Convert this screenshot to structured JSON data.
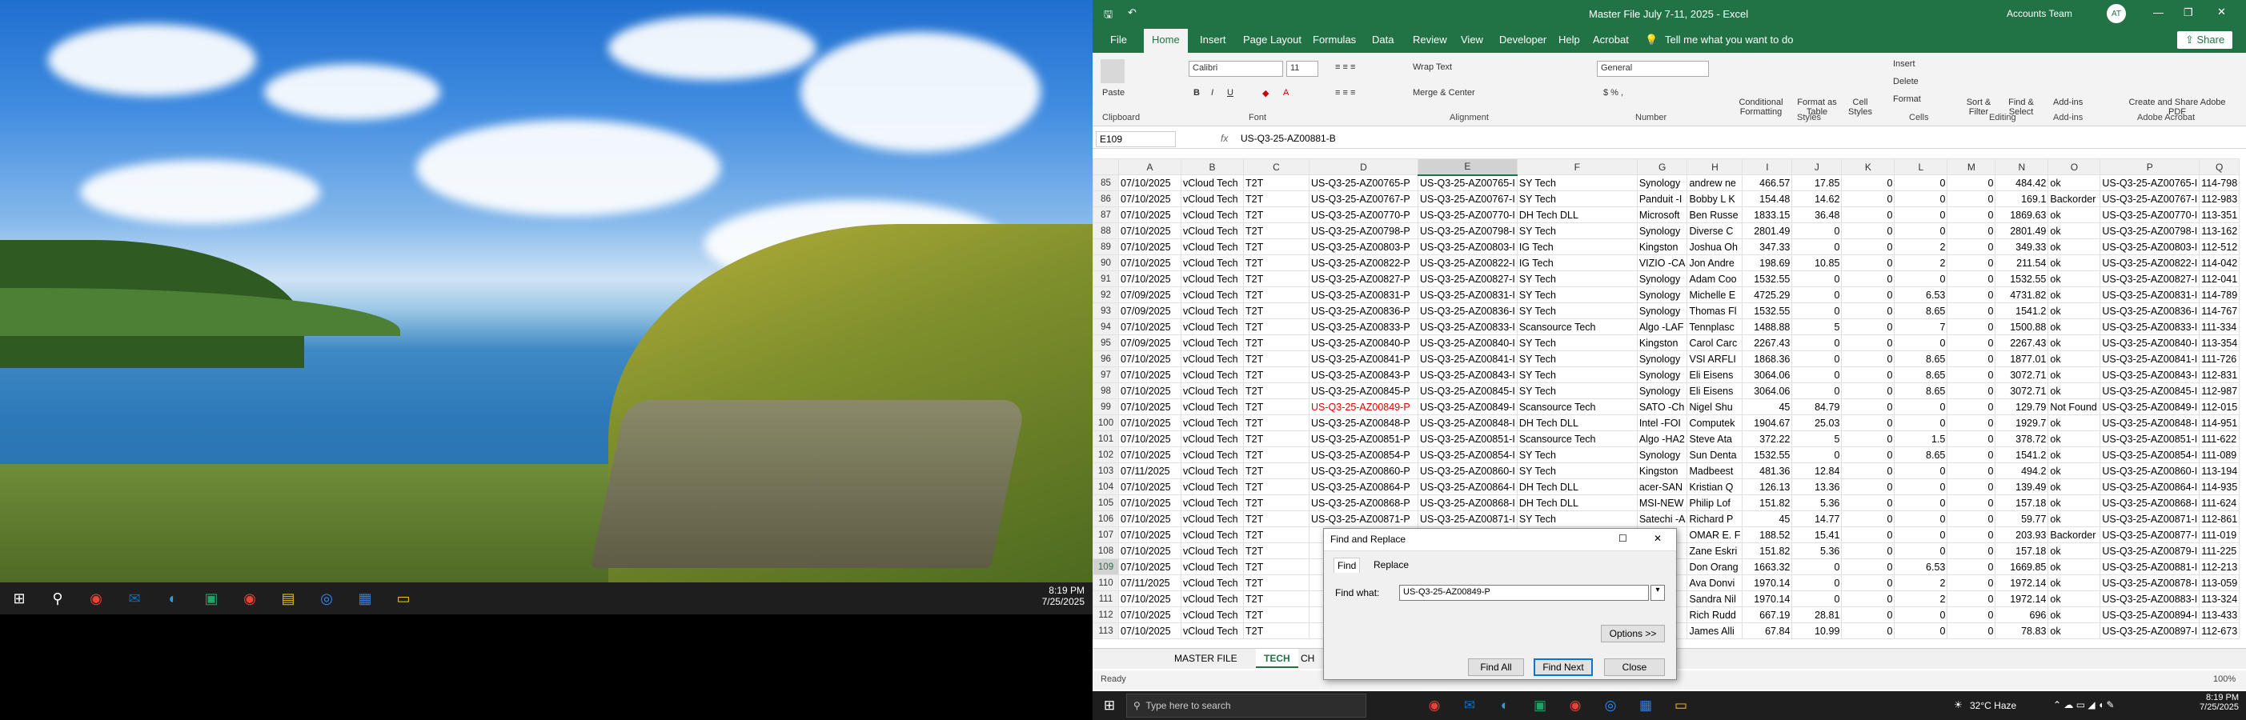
{
  "left_taskbar": {
    "time": "8:19 PM",
    "date": "7/25/2025"
  },
  "title_bar": {
    "file_name": "Master File July 7-11, 2025 - Excel",
    "account": "Accounts Team",
    "initials": "AT"
  },
  "ribbon_tabs": [
    "File",
    "Home",
    "Insert",
    "Page Layout",
    "Formulas",
    "Data",
    "Review",
    "View",
    "Developer",
    "Help",
    "Acrobat",
    "Tell me what you want to do"
  ],
  "share_label": "Share",
  "ribbon": {
    "paste": "Paste",
    "clipboard": "Clipboard",
    "font_name": "Calibri",
    "font_size": "11",
    "font": "Font",
    "wrap_text": "Wrap Text",
    "merge_center": "Merge & Center",
    "alignment": "Alignment",
    "number_format": "General",
    "number": "Number",
    "conditional": "Conditional Formatting",
    "format_table": "Format as Table",
    "cell_styles": "Cell Styles",
    "styles": "Styles",
    "insert": "Insert",
    "delete": "Delete",
    "format": "Format",
    "cells": "Cells",
    "sort_filter": "Sort & Filter",
    "find_select": "Find & Select",
    "editing": "Editing",
    "addins": "Add-ins",
    "addins_group": "Add-ins",
    "create_pdf": "Create and Share Adobe PDF",
    "adobe_acrobat": "Adobe Acrobat"
  },
  "formula_bar": {
    "name_box": "E109",
    "fx": "fx",
    "content": "US-Q3-25-AZ00881-B"
  },
  "columns": [
    "A",
    "B",
    "C",
    "D",
    "E",
    "F",
    "G",
    "H",
    "I",
    "J",
    "K",
    "L",
    "M",
    "N",
    "O",
    "P",
    "Q"
  ],
  "rows": [
    [
      "85",
      "07/10/2025",
      "vCloud Tech",
      "T2T",
      "US-Q3-25-AZ00765-P",
      "US-Q3-25-AZ00765-I",
      "SY Tech",
      "Synology",
      "andrew ne",
      "466.57",
      "17.85",
      "0",
      "0",
      "0",
      "484.42",
      "ok",
      "US-Q3-25-AZ00765-I",
      "114-798"
    ],
    [
      "86",
      "07/10/2025",
      "vCloud Tech",
      "T2T",
      "US-Q3-25-AZ00767-P",
      "US-Q3-25-AZ00767-I",
      "SY Tech",
      "Panduit -I",
      "Bobby L K",
      "154.48",
      "14.62",
      "0",
      "0",
      "0",
      "169.1",
      "Backorder",
      "US-Q3-25-AZ00767-I",
      "112-983"
    ],
    [
      "87",
      "07/10/2025",
      "vCloud Tech",
      "T2T",
      "US-Q3-25-AZ00770-P",
      "US-Q3-25-AZ00770-I",
      "DH Tech DLL",
      "Microsoft",
      "Ben Russe",
      "1833.15",
      "36.48",
      "0",
      "0",
      "0",
      "1869.63",
      "ok",
      "US-Q3-25-AZ00770-I",
      "113-351"
    ],
    [
      "88",
      "07/10/2025",
      "vCloud Tech",
      "T2T",
      "US-Q3-25-AZ00798-P",
      "US-Q3-25-AZ00798-I",
      "SY Tech",
      "Synology",
      "Diverse C",
      "2801.49",
      "0",
      "0",
      "0",
      "0",
      "2801.49",
      "ok",
      "US-Q3-25-AZ00798-I",
      "113-162"
    ],
    [
      "89",
      "07/10/2025",
      "vCloud Tech",
      "T2T",
      "US-Q3-25-AZ00803-P",
      "US-Q3-25-AZ00803-I",
      "IG Tech",
      "Kingston",
      "Joshua Oh",
      "347.33",
      "0",
      "0",
      "2",
      "0",
      "349.33",
      "ok",
      "US-Q3-25-AZ00803-I",
      "112-512"
    ],
    [
      "90",
      "07/10/2025",
      "vCloud Tech",
      "T2T",
      "US-Q3-25-AZ00822-P",
      "US-Q3-25-AZ00822-I",
      "IG Tech",
      "VIZIO -CA",
      "Jon Andre",
      "198.69",
      "10.85",
      "0",
      "2",
      "0",
      "211.54",
      "ok",
      "US-Q3-25-AZ00822-I",
      "114-042"
    ],
    [
      "91",
      "07/10/2025",
      "vCloud Tech",
      "T2T",
      "US-Q3-25-AZ00827-P",
      "US-Q3-25-AZ00827-I",
      "SY Tech",
      "Synology",
      "Adam Coo",
      "1532.55",
      "0",
      "0",
      "0",
      "0",
      "1532.55",
      "ok",
      "US-Q3-25-AZ00827-I",
      "112-041"
    ],
    [
      "92",
      "07/09/2025",
      "vCloud Tech",
      "T2T",
      "US-Q3-25-AZ00831-P",
      "US-Q3-25-AZ00831-I",
      "SY Tech",
      "Synology",
      "Michelle E",
      "4725.29",
      "0",
      "0",
      "6.53",
      "0",
      "4731.82",
      "ok",
      "US-Q3-25-AZ00831-I",
      "114-789"
    ],
    [
      "93",
      "07/09/2025",
      "vCloud Tech",
      "T2T",
      "US-Q3-25-AZ00836-P",
      "US-Q3-25-AZ00836-I",
      "SY Tech",
      "Synology",
      "Thomas Fl",
      "1532.55",
      "0",
      "0",
      "8.65",
      "0",
      "1541.2",
      "ok",
      "US-Q3-25-AZ00836-I",
      "114-767"
    ],
    [
      "94",
      "07/10/2025",
      "vCloud Tech",
      "T2T",
      "US-Q3-25-AZ00833-P",
      "US-Q3-25-AZ00833-I",
      "Scansource Tech",
      "Algo -LAF",
      "Tennplasc",
      "1488.88",
      "5",
      "0",
      "7",
      "0",
      "1500.88",
      "ok",
      "US-Q3-25-AZ00833-I",
      "111-334"
    ],
    [
      "95",
      "07/09/2025",
      "vCloud Tech",
      "T2T",
      "US-Q3-25-AZ00840-P",
      "US-Q3-25-AZ00840-I",
      "SY Tech",
      "Kingston",
      "Carol Carc",
      "2267.43",
      "0",
      "0",
      "0",
      "0",
      "2267.43",
      "ok",
      "US-Q3-25-AZ00840-I",
      "113-354"
    ],
    [
      "96",
      "07/10/2025",
      "vCloud Tech",
      "T2T",
      "US-Q3-25-AZ00841-P",
      "US-Q3-25-AZ00841-I",
      "SY Tech",
      "Synology",
      "VSI ARFLI",
      "1868.36",
      "0",
      "0",
      "8.65",
      "0",
      "1877.01",
      "ok",
      "US-Q3-25-AZ00841-I",
      "111-726"
    ],
    [
      "97",
      "07/10/2025",
      "vCloud Tech",
      "T2T",
      "US-Q3-25-AZ00843-P",
      "US-Q3-25-AZ00843-I",
      "SY Tech",
      "Synology",
      "Eli Eisens",
      "3064.06",
      "0",
      "0",
      "8.65",
      "0",
      "3072.71",
      "ok",
      "US-Q3-25-AZ00843-I",
      "112-831"
    ],
    [
      "98",
      "07/10/2025",
      "vCloud Tech",
      "T2T",
      "US-Q3-25-AZ00845-P",
      "US-Q3-25-AZ00845-I",
      "SY Tech",
      "Synology",
      "Eli Eisens",
      "3064.06",
      "0",
      "0",
      "8.65",
      "0",
      "3072.71",
      "ok",
      "US-Q3-25-AZ00845-I",
      "112-987"
    ],
    [
      "99",
      "07/10/2025",
      "vCloud Tech",
      "T2T",
      "US-Q3-25-AZ00849-P",
      "US-Q3-25-AZ00849-I",
      "Scansource Tech",
      "SATO -Ch",
      "Nigel Shu",
      "45",
      "84.79",
      "0",
      "0",
      "0",
      "129.79",
      "Not Found",
      "US-Q3-25-AZ00849-I",
      "112-015"
    ],
    [
      "100",
      "07/10/2025",
      "vCloud Tech",
      "T2T",
      "US-Q3-25-AZ00848-P",
      "US-Q3-25-AZ00848-I",
      "DH Tech DLL",
      "Intel -FOI",
      "Computek",
      "1904.67",
      "25.03",
      "0",
      "0",
      "0",
      "1929.7",
      "ok",
      "US-Q3-25-AZ00848-I",
      "114-951"
    ],
    [
      "101",
      "07/10/2025",
      "vCloud Tech",
      "T2T",
      "US-Q3-25-AZ00851-P",
      "US-Q3-25-AZ00851-I",
      "Scansource Tech",
      "Algo -HA2",
      "Steve Ata",
      "372.22",
      "5",
      "0",
      "1.5",
      "0",
      "378.72",
      "ok",
      "US-Q3-25-AZ00851-I",
      "111-622"
    ],
    [
      "102",
      "07/10/2025",
      "vCloud Tech",
      "T2T",
      "US-Q3-25-AZ00854-P",
      "US-Q3-25-AZ00854-I",
      "SY Tech",
      "Synology",
      "Sun Denta",
      "1532.55",
      "0",
      "0",
      "8.65",
      "0",
      "1541.2",
      "ok",
      "US-Q3-25-AZ00854-I",
      "111-089"
    ],
    [
      "103",
      "07/11/2025",
      "vCloud Tech",
      "T2T",
      "US-Q3-25-AZ00860-P",
      "US-Q3-25-AZ00860-I",
      "SY Tech",
      "Kingston",
      "Madbeest",
      "481.36",
      "12.84",
      "0",
      "0",
      "0",
      "494.2",
      "ok",
      "US-Q3-25-AZ00860-I",
      "113-194"
    ],
    [
      "104",
      "07/10/2025",
      "vCloud Tech",
      "T2T",
      "US-Q3-25-AZ00864-P",
      "US-Q3-25-AZ00864-I",
      "DH Tech DLL",
      "acer-SAN",
      "Kristian Q",
      "126.13",
      "13.36",
      "0",
      "0",
      "0",
      "139.49",
      "ok",
      "US-Q3-25-AZ00864-I",
      "114-935"
    ],
    [
      "105",
      "07/10/2025",
      "vCloud Tech",
      "T2T",
      "US-Q3-25-AZ00868-P",
      "US-Q3-25-AZ00868-I",
      "DH Tech DLL",
      "MSI-NEW",
      "Philip Lof",
      "151.82",
      "5.36",
      "0",
      "0",
      "0",
      "157.18",
      "ok",
      "US-Q3-25-AZ00868-I",
      "111-624"
    ],
    [
      "106",
      "07/10/2025",
      "vCloud Tech",
      "T2T",
      "US-Q3-25-AZ00871-P",
      "US-Q3-25-AZ00871-I",
      "SY Tech",
      "Satechi -A",
      "Richard P",
      "45",
      "14.77",
      "0",
      "0",
      "0",
      "59.77",
      "ok",
      "US-Q3-25-AZ00871-I",
      "112-861"
    ],
    [
      "107",
      "07/10/2025",
      "vCloud Tech",
      "T2T",
      "",
      "",
      "",
      "",
      "OMAR E. F",
      "188.52",
      "15.41",
      "0",
      "0",
      "0",
      "203.93",
      "Backorder",
      "US-Q3-25-AZ00877-I",
      "111-019"
    ],
    [
      "108",
      "07/10/2025",
      "vCloud Tech",
      "T2T",
      "",
      "",
      "",
      "",
      "Zane Eskri",
      "151.82",
      "5.36",
      "0",
      "0",
      "0",
      "157.18",
      "ok",
      "US-Q3-25-AZ00879-I",
      "111-225"
    ],
    [
      "109",
      "07/10/2025",
      "vCloud Tech",
      "T2T",
      "",
      "",
      "",
      "",
      "Don Orang",
      "1663.32",
      "0",
      "0",
      "6.53",
      "0",
      "1669.85",
      "ok",
      "US-Q3-25-AZ00881-I",
      "112-213"
    ],
    [
      "110",
      "07/11/2025",
      "vCloud Tech",
      "T2T",
      "",
      "",
      "",
      "",
      "Ava Donvi",
      "1970.14",
      "0",
      "0",
      "2",
      "0",
      "1972.14",
      "ok",
      "US-Q3-25-AZ00878-I",
      "113-059"
    ],
    [
      "111",
      "07/10/2025",
      "vCloud Tech",
      "T2T",
      "",
      "",
      "",
      "",
      "Sandra Nil",
      "1970.14",
      "0",
      "0",
      "2",
      "0",
      "1972.14",
      "ok",
      "US-Q3-25-AZ00883-I",
      "113-324"
    ],
    [
      "112",
      "07/10/2025",
      "vCloud Tech",
      "T2T",
      "",
      "",
      "",
      "",
      "Rich Rudd",
      "667.19",
      "28.81",
      "0",
      "0",
      "0",
      "696",
      "ok",
      "US-Q3-25-AZ00894-I",
      "113-433"
    ],
    [
      "113",
      "07/10/2025",
      "vCloud Tech",
      "T2T",
      "",
      "",
      "",
      "",
      "James Alli",
      "67.84",
      "10.99",
      "0",
      "0",
      "0",
      "78.83",
      "ok",
      "US-Q3-25-AZ00897-I",
      "112-673"
    ]
  ],
  "red_row": "99",
  "sheet_tabs": [
    "MASTER FILE",
    "TECH",
    "CH"
  ],
  "active_sheet": "TECH",
  "status": {
    "ready": "Ready",
    "zoom": "100%"
  },
  "dialog": {
    "title": "Find and Replace",
    "tab_find": "Find",
    "tab_replace": "Replace",
    "find_label": "Find what:",
    "find_value": "US-Q3-25-AZ00849-P",
    "options": "Options >>",
    "find_all": "Find All",
    "find_next": "Find Next",
    "close": "Close"
  },
  "right_taskbar": {
    "search_placeholder": "Type here to search",
    "weather": "32°C Haze",
    "time": "8:19 PM",
    "date": "7/25/2025"
  }
}
